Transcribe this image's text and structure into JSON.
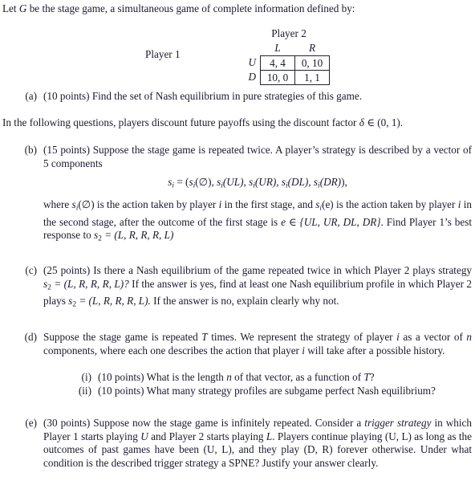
{
  "document": {
    "intro": "Let G be the stage game, a simultaneous game of complete information defined by:",
    "intro_parts": {
      "before": "Let ",
      "var": "G",
      "after": " be the stage game, a simultaneous game of complete information defined by:"
    },
    "matrix": {
      "player2_label": "Player 2",
      "player1_label": "Player 1",
      "col_headers": [
        "L",
        "R"
      ],
      "row_headers": [
        "U",
        "D"
      ],
      "cells": [
        [
          "4, 4",
          "0, 10"
        ],
        [
          "10, 0",
          "1, 1"
        ]
      ]
    },
    "item_a": {
      "label": "(a)",
      "points": "(10 points)",
      "text": "Find the set of Nash equilibrium in pure strategies of this game."
    },
    "discount_para": {
      "before": "In the following questions, players discount future payoffs using the discount factor ",
      "symbol": "δ",
      "after": " ∈ (0, 1)."
    },
    "item_b": {
      "label": "(b)",
      "points": "(15 points)",
      "text_1": "Suppose the stage game is repeated twice. A player’s strategy is described by a vector of 5 components",
      "formula": "sᵢ = (sᵢ(∅), sᵢ(UL), sᵢ(UR), sᵢ(DL), sᵢ(DR)),",
      "formula_parts": {
        "lhs_var": "s",
        "lhs_sub": "i",
        "eq": " = (",
        "args": [
          "(∅)",
          "(UL)",
          "(UR)",
          "(DL)",
          "(DR)"
        ],
        "tail": "),"
      },
      "text_2_a": "where ",
      "text_2_b": "(∅) is the action taken by player ",
      "text_2_c": " in the first stage, and ",
      "text_2_d": "(e) is the action taken by player ",
      "text_2_e": " in the second stage, after the outcome of the first stage is ",
      "text_2_f": "e ∈ {UL, UR, DL, DR}",
      "text_2_g": ". Find Player 1’s best response to ",
      "text_2_h": " = (L, R, R, R, L)"
    },
    "item_c": {
      "label": "(c)",
      "points": "(25 points)",
      "text_a": "Is there a Nash equilibrium of the game repeated twice in which Player 2 plays strategy ",
      "strategy_1": " = (L, R, R, R, L)?",
      "text_b": " If the answer is yes, find at least one Nash equilibrium profile in which Player 2 plays ",
      "strategy_2": " = (L, R, R, R, L).",
      "text_c": " If the answer is no, explain clearly why not."
    },
    "item_d": {
      "label": "(d)",
      "text_a": "Suppose the stage game is repeated ",
      "var_T": "T",
      "text_b": " times. We represent the strategy of player ",
      "var_i": "i",
      "text_c": " as a vector of ",
      "var_n": "n",
      "text_d": " components, where each one describes the action that player ",
      "var_i2": "i",
      "text_e": " will take after a possible history.",
      "subitems": [
        {
          "label": "(i)",
          "points": "(10 points)",
          "text_a": "What is the length ",
          "var_n": "n",
          "text_b": " of that vector, as a function of ",
          "var_T": "T",
          "text_c": "?"
        },
        {
          "label": "(ii)",
          "points": "(10 points)",
          "text_a": "What many strategy profiles are subgame perfect Nash equilibrium?",
          "var_n": "",
          "text_b": "",
          "var_T": "",
          "text_c": ""
        }
      ]
    },
    "item_e": {
      "label": "(e)",
      "points": "(30 points)",
      "text_a": "Suppose now the stage game is infinitely repeated. Consider a ",
      "italic_term": "trigger strategy",
      "text_b": " in which Player 1 starts playing ",
      "var_U": "U",
      "text_c": " and Player 2 starts playing ",
      "var_L": "L",
      "text_d": ". Players continue playing (U, L) as long as the outcomes of past games have been (U, L), and they play (D, R) forever otherwise. Under what condition is the described trigger strategy a SPNE? Justify your answer clearly."
    }
  }
}
